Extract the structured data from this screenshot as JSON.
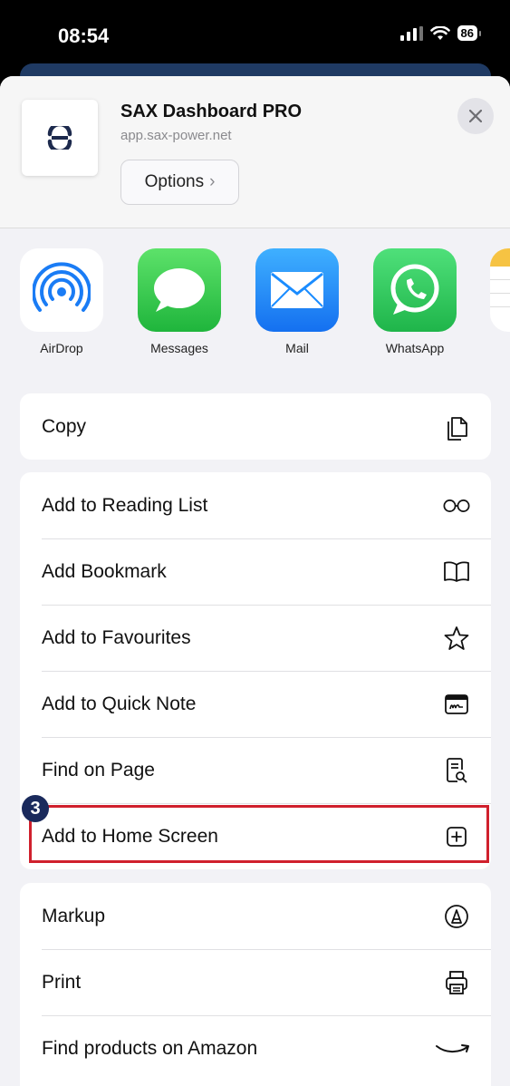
{
  "status": {
    "time": "08:54",
    "battery": "86"
  },
  "header": {
    "app_title": "SAX Dashboard PRO",
    "app_url": "app.sax-power.net",
    "options_label": "Options",
    "options_chevron": "›"
  },
  "share_apps": [
    {
      "label": "AirDrop",
      "icon": "airdrop-icon"
    },
    {
      "label": "Messages",
      "icon": "messages-icon"
    },
    {
      "label": "Mail",
      "icon": "mail-icon"
    },
    {
      "label": "WhatsApp",
      "icon": "whatsapp-icon"
    }
  ],
  "groups": {
    "copy": [
      {
        "label": "Copy",
        "icon": "copy-icon"
      }
    ],
    "actions": [
      {
        "label": "Add to Reading List",
        "icon": "glasses-icon"
      },
      {
        "label": "Add Bookmark",
        "icon": "book-icon"
      },
      {
        "label": "Add to Favourites",
        "icon": "star-icon"
      },
      {
        "label": "Add to Quick Note",
        "icon": "quick-note-icon"
      },
      {
        "label": "Find on Page",
        "icon": "find-on-page-icon"
      },
      {
        "label": "Add to Home Screen",
        "icon": "plus-square-icon"
      }
    ],
    "more": [
      {
        "label": "Markup",
        "icon": "markup-icon"
      },
      {
        "label": "Print",
        "icon": "printer-icon"
      },
      {
        "label": "Find products on Amazon",
        "icon": "amazon-icon"
      }
    ]
  },
  "annotation": {
    "step_number": "3"
  },
  "colors": {
    "highlight": "#d0202d",
    "badge": "#1a2a5c",
    "messages_green": "#34c759",
    "mail_blue": "#1a8cff",
    "whatsapp_green": "#25d366",
    "airdrop_blue": "#1a7cf5"
  }
}
